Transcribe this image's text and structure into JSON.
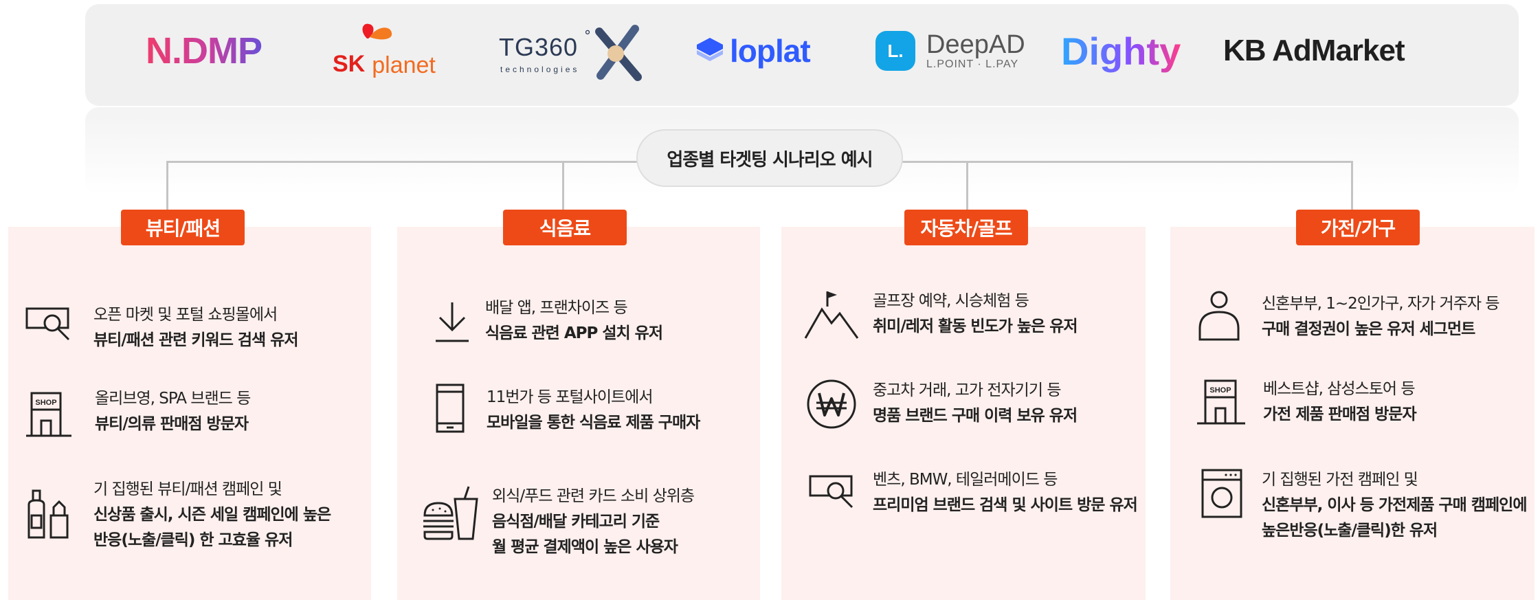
{
  "logos": [
    {
      "name": "ndmp",
      "text": "N.DMP"
    },
    {
      "name": "sk-planet",
      "sk": "SK",
      "planet": "planet"
    },
    {
      "name": "tg360",
      "main": "TG360",
      "degree": "°",
      "sub": "technologies"
    },
    {
      "name": "loplat",
      "text": "loplat"
    },
    {
      "name": "deepad",
      "main": "DeepAD",
      "sub": "L.POINT · L.PAY",
      "mark": "L."
    },
    {
      "name": "dighty",
      "text": "Dighty"
    },
    {
      "name": "kb-admarket",
      "text": "KB AdMarket"
    }
  ],
  "center_title": "업종별 타겟팅 시나리오 예시",
  "colors": {
    "accent": "#ee4a17",
    "panel": "#fdf0ee",
    "logo_bar": "#f0f0f0"
  },
  "columns": [
    {
      "title": "뷰티/패션",
      "items": [
        {
          "icon": "search-screen-icon",
          "lines": [
            "오픈 마켓 및 포털 쇼핑몰에서",
            "뷰티/패션 관련 키워드 검색 유저"
          ]
        },
        {
          "icon": "shop-icon",
          "shop_label": "SHOP",
          "lines": [
            "올리브영, SPA 브랜드 등",
            "뷰티/의류 판매점 방문자"
          ]
        },
        {
          "icon": "cosmetics-icon",
          "lines": [
            "기 집행된 뷰티/패션 캠페인 및",
            "신상품 출시, 시즌 세일 캠페인에 높은",
            "반응(노출/클릭) 한 고효율 유저"
          ]
        }
      ]
    },
    {
      "title": "식음료",
      "items": [
        {
          "icon": "download-icon",
          "lines": [
            "배달 앱, 프랜차이즈 등",
            "식음료 관련 APP 설치 유저"
          ]
        },
        {
          "icon": "mobile-icon",
          "lines": [
            "11번가 등 포털사이트에서",
            "모바일을 통한 식음료 제품 구매자"
          ]
        },
        {
          "icon": "fastfood-icon",
          "lines": [
            "외식/푸드 관련 카드 소비 상위층",
            "음식점/배달 카테고리 기준",
            "월 평균 결제액이 높은 사용자"
          ]
        }
      ]
    },
    {
      "title": "자동차/골프",
      "items": [
        {
          "icon": "mountain-flag-icon",
          "lines": [
            "골프장 예약, 시승체험 등",
            "취미/레저 활동 빈도가 높은 유저"
          ]
        },
        {
          "icon": "won-icon",
          "lines": [
            "중고차 거래, 고가 전자기기 등",
            "명품 브랜드 구매 이력 보유 유저"
          ]
        },
        {
          "icon": "search-screen-icon",
          "lines": [
            "벤츠, BMW, 테일러메이드 등",
            "프리미엄 브랜드 검색 및 사이트 방문 유저"
          ]
        }
      ]
    },
    {
      "title": "가전/가구",
      "items": [
        {
          "icon": "person-icon",
          "lines": [
            "신혼부부, 1~2인가구, 자가 거주자 등",
            "구매 결정권이 높은 유저 세그먼트"
          ]
        },
        {
          "icon": "shop-icon",
          "shop_label": "SHOP",
          "lines": [
            "베스트샵, 삼성스토어 등",
            "가전 제품 판매점 방문자"
          ]
        },
        {
          "icon": "washing-machine-icon",
          "lines": [
            "기 집행된 가전 캠페인 및",
            "신혼부부, 이사 등 가전제품 구매 캠페인에",
            "높은반응(노출/클릭)한 유저"
          ]
        }
      ]
    }
  ]
}
